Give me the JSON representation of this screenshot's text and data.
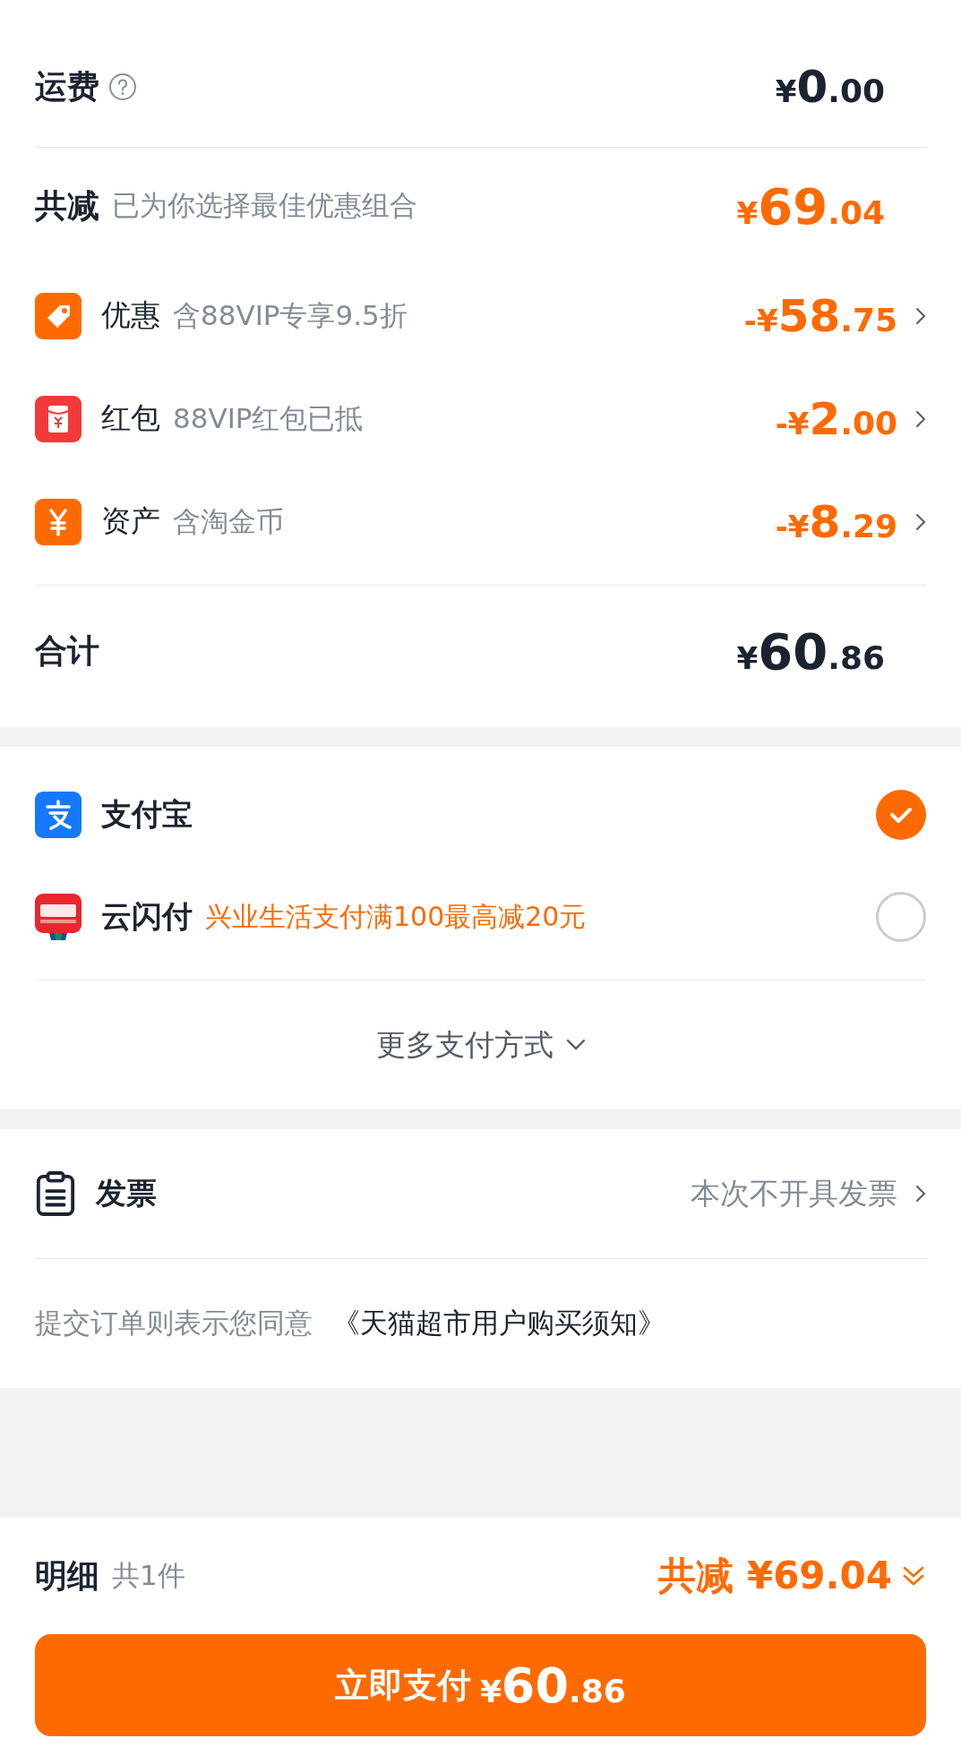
{
  "summary": {
    "shipping": {
      "label": "运费",
      "amount": "¥0.00"
    },
    "discount": {
      "label": "共减",
      "note": "已为你选择最佳优惠组合",
      "amount": "¥69.04"
    },
    "items": [
      {
        "kind": "coupon",
        "label": "优惠",
        "note": "含88VIP专享9.5折",
        "amount": "-¥58.75"
      },
      {
        "kind": "red_packet",
        "label": "红包",
        "note": "88VIP红包已抵",
        "amount": "-¥2.00"
      },
      {
        "kind": "assets",
        "label": "资产",
        "note": "含淘金币",
        "amount": "-¥8.29"
      }
    ],
    "total": {
      "label": "合计",
      "amount": "¥60.86"
    }
  },
  "payment": {
    "methods": [
      {
        "kind": "alipay",
        "name": "支付宝",
        "selected": true
      },
      {
        "kind": "unionpay",
        "name": "云闪付",
        "promo": "兴业生活支付满100最高减20元",
        "selected": false
      }
    ],
    "more": "更多支付方式"
  },
  "invoice": {
    "label": "发票",
    "value": "本次不开具发票"
  },
  "agreement": {
    "text": "提交订单则表示您同意",
    "link": "《天猫超市用户购买须知》"
  },
  "footer": {
    "details": "明细",
    "count": "共1件",
    "discount_label": "共减",
    "discount": "¥69.04",
    "pay_label": "立即支付",
    "pay_amount": "¥60.86"
  }
}
